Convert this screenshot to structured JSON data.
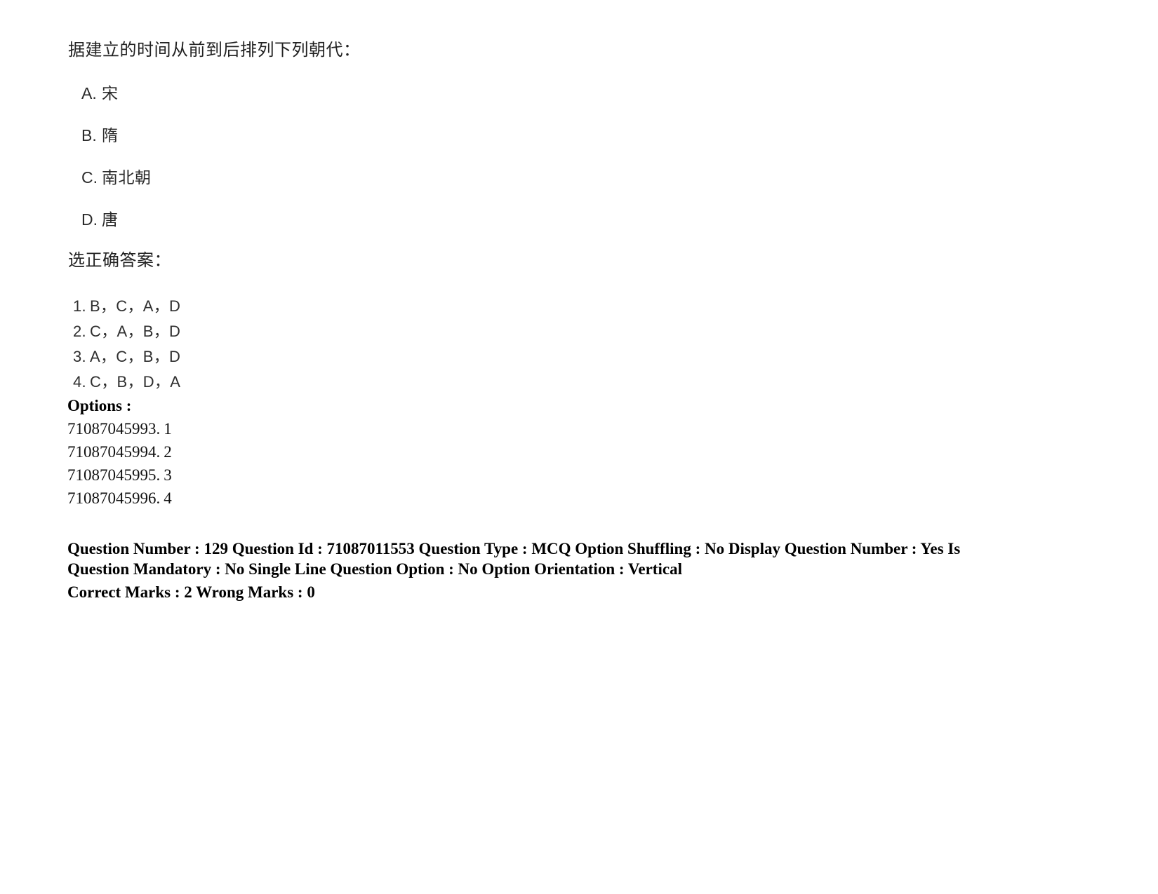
{
  "question": {
    "stem": "据建立的时间从前到后排列下列朝代："
  },
  "choices": [
    {
      "letter": "A.",
      "text": "宋"
    },
    {
      "letter": "B.",
      "text": "隋"
    },
    {
      "letter": "C.",
      "text": "南北朝"
    },
    {
      "letter": "D.",
      "text": "唐"
    }
  ],
  "answer_prompt": "选正确答案：",
  "answers": [
    {
      "number": "1.",
      "sequence": "B，C，A，D"
    },
    {
      "number": "2.",
      "sequence": "C，A，B，D"
    },
    {
      "number": "3.",
      "sequence": "A，C，B，D"
    },
    {
      "number": "4.",
      "sequence": "C，B，D，A"
    }
  ],
  "options": {
    "label": "Options :",
    "items": [
      {
        "id": "71087045993.",
        "value": "1"
      },
      {
        "id": "71087045994.",
        "value": "2"
      },
      {
        "id": "71087045995.",
        "value": "3"
      },
      {
        "id": "71087045996.",
        "value": "4"
      }
    ]
  },
  "meta": {
    "line1": "Question Number : 129 Question Id : 71087011553 Question Type : MCQ Option Shuffling : No Display Question Number : Yes Is Question Mandatory : No Single Line Question Option : No Option Orientation : Vertical",
    "line2": "Correct Marks : 2 Wrong Marks : 0"
  },
  "colors": {
    "background": "#ffffff",
    "body_text": "#1a1a1a",
    "meta_text": "#000000"
  }
}
